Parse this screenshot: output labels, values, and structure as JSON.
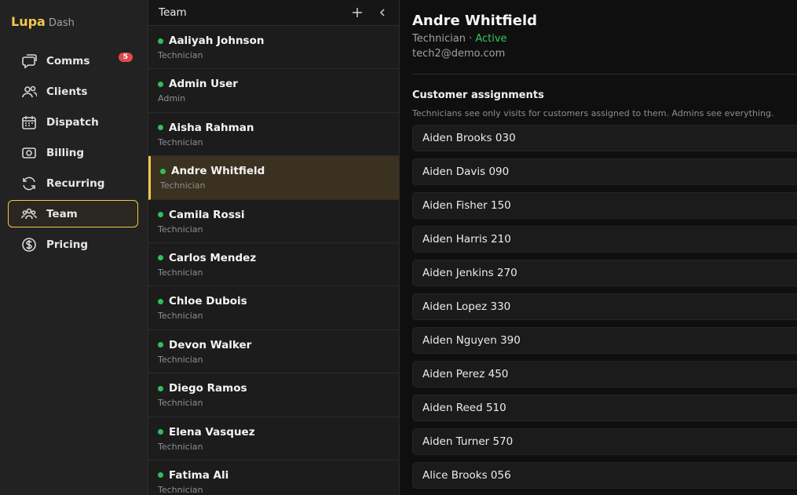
{
  "brand": {
    "main": "Lupa",
    "sub": "Dash"
  },
  "nav": [
    {
      "id": "comms",
      "label": "Comms",
      "icon": "chat-icon",
      "badge": "5"
    },
    {
      "id": "clients",
      "label": "Clients",
      "icon": "users-icon"
    },
    {
      "id": "dispatch",
      "label": "Dispatch",
      "icon": "calendar-icon"
    },
    {
      "id": "billing",
      "label": "Billing",
      "icon": "billing-icon"
    },
    {
      "id": "recurring",
      "label": "Recurring",
      "icon": "refresh-icon"
    },
    {
      "id": "team",
      "label": "Team",
      "icon": "team-icon",
      "active": true
    },
    {
      "id": "pricing",
      "label": "Pricing",
      "icon": "dollar-icon"
    }
  ],
  "team": {
    "title": "Team",
    "add_icon": "plus-icon",
    "collapse_icon": "chevron-left-icon",
    "members": [
      {
        "name": "Aaliyah Johnson",
        "role": "Technician"
      },
      {
        "name": "Admin User",
        "role": "Admin"
      },
      {
        "name": "Aisha Rahman",
        "role": "Technician"
      },
      {
        "name": "Andre Whitfield",
        "role": "Technician",
        "selected": true
      },
      {
        "name": "Camila Rossi",
        "role": "Technician"
      },
      {
        "name": "Carlos Mendez",
        "role": "Technician"
      },
      {
        "name": "Chloe Dubois",
        "role": "Technician"
      },
      {
        "name": "Devon Walker",
        "role": "Technician"
      },
      {
        "name": "Diego Ramos",
        "role": "Technician"
      },
      {
        "name": "Elena Vasquez",
        "role": "Technician"
      },
      {
        "name": "Fatima Ali",
        "role": "Technician"
      }
    ]
  },
  "detail": {
    "name": "Andre Whitfield",
    "role": "Technician",
    "separator": " · ",
    "status": "Active",
    "email": "tech2@demo.com",
    "section_title": "Customer assignments",
    "section_desc": "Technicians see only visits for customers assigned to them. Admins see everything.",
    "assignments": [
      "Aiden Brooks 030",
      "Aiden Davis 090",
      "Aiden Fisher 150",
      "Aiden Harris 210",
      "Aiden Jenkins 270",
      "Aiden Lopez 330",
      "Aiden Nguyen 390",
      "Aiden Perez 450",
      "Aiden Reed 510",
      "Aiden Turner 570",
      "Alice Brooks 056"
    ]
  },
  "colors": {
    "accent": "#f3c84b",
    "status_green": "#34c759",
    "badge_red": "#e34848"
  }
}
